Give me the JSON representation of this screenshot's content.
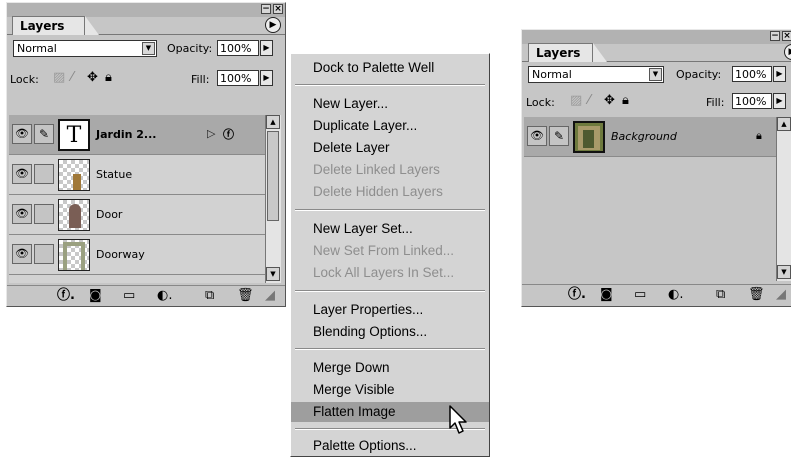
{
  "left_palette": {
    "tab_label": "Layers",
    "blend_mode": "Normal",
    "opacity_label": "Opacity:",
    "opacity_value": "100%",
    "lock_label": "Lock:",
    "fill_label": "Fill:",
    "fill_value": "100%",
    "layers": [
      {
        "name": "Jardin 2...",
        "selected": true,
        "type": "text"
      },
      {
        "name": "Statue",
        "selected": false,
        "type": "image"
      },
      {
        "name": "Door",
        "selected": false,
        "type": "image"
      },
      {
        "name": "Doorway",
        "selected": false,
        "type": "image"
      }
    ]
  },
  "menu": {
    "items": [
      {
        "label": "Dock to Palette Well",
        "disabled": false
      },
      {
        "label": "New Layer...",
        "disabled": false
      },
      {
        "label": "Duplicate Layer...",
        "disabled": false
      },
      {
        "label": "Delete Layer",
        "disabled": false
      },
      {
        "label": "Delete Linked Layers",
        "disabled": true
      },
      {
        "label": "Delete Hidden Layers",
        "disabled": true
      },
      {
        "label": "New Layer Set...",
        "disabled": false
      },
      {
        "label": "New Set From Linked...",
        "disabled": true
      },
      {
        "label": "Lock All Layers In Set...",
        "disabled": true
      },
      {
        "label": "Layer Properties...",
        "disabled": false
      },
      {
        "label": "Blending Options...",
        "disabled": false
      },
      {
        "label": "Merge Down",
        "disabled": false
      },
      {
        "label": "Merge Visible",
        "disabled": false
      },
      {
        "label": "Flatten Image",
        "disabled": false,
        "highlighted": true
      },
      {
        "label": "Palette Options...",
        "disabled": false
      }
    ]
  },
  "right_palette": {
    "tab_label": "Layers",
    "blend_mode": "Normal",
    "opacity_label": "Opacity:",
    "opacity_value": "100%",
    "lock_label": "Lock:",
    "fill_label": "Fill:",
    "fill_value": "100%",
    "layers": [
      {
        "name": "Background",
        "selected": true,
        "locked": true
      }
    ]
  },
  "icons": {
    "eye": "eye-icon",
    "brush": "brush-icon",
    "lock": "lock-icon",
    "move": "move-icon",
    "effects": "layer-style-icon",
    "mask": "add-mask-icon",
    "folder": "new-set-icon",
    "adjust": "adjustment-layer-icon",
    "new": "new-layer-icon",
    "trash": "trash-icon"
  }
}
